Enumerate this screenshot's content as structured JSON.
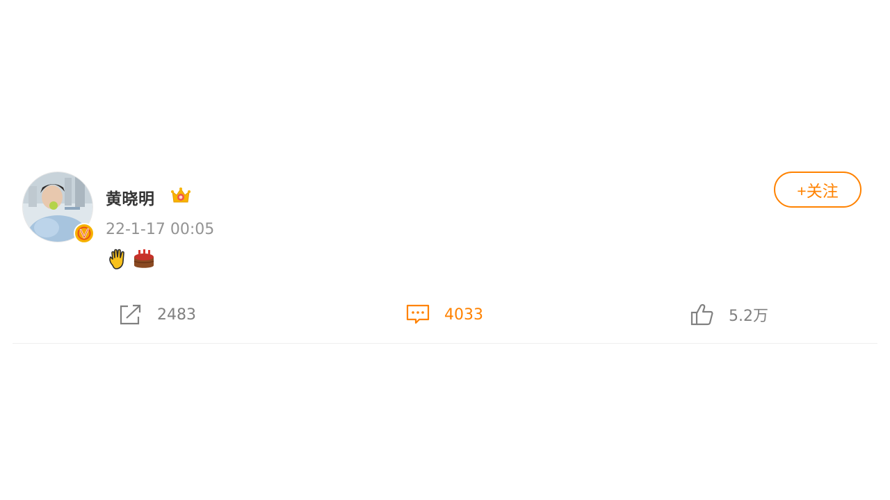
{
  "post": {
    "user": {
      "name": "黄晓明",
      "badge_icon": "crown-icon",
      "verified_icon": "verified-v-icon"
    },
    "timestamp": "22-1-17 00:05",
    "content_emojis": [
      "waving-hand-icon",
      "birthday-cake-icon"
    ],
    "follow_label": "+关注",
    "actions": {
      "share": {
        "icon": "share-icon",
        "count": "2483"
      },
      "comment": {
        "icon": "comment-icon",
        "count": "4033"
      },
      "like": {
        "icon": "thumbs-up-icon",
        "count": "5.2万"
      }
    }
  },
  "colors": {
    "accent": "#ff8200",
    "text_primary": "#333333",
    "text_secondary": "#939393"
  }
}
